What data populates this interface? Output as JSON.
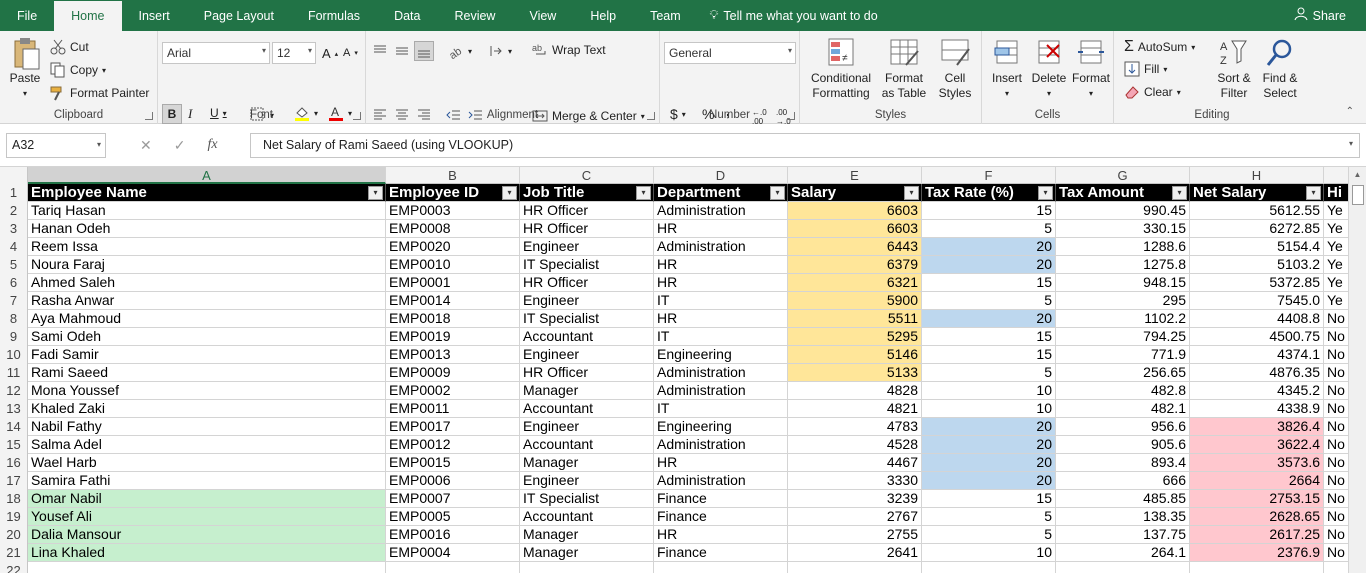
{
  "tabs": [
    "File",
    "Home",
    "Insert",
    "Page Layout",
    "Formulas",
    "Data",
    "Review",
    "View",
    "Help",
    "Team"
  ],
  "tell_me": "Tell me what you want to do",
  "share": "Share",
  "clipboard": {
    "paste": "Paste",
    "cut": "Cut",
    "copy": "Copy",
    "format_painter": "Format Painter",
    "label": "Clipboard"
  },
  "font": {
    "name": "Arial",
    "size": "12",
    "label": "Font",
    "bold": "B",
    "italic": "I",
    "underline": "U"
  },
  "alignment": {
    "wrap": "Wrap Text",
    "merge": "Merge & Center",
    "label": "Alignment"
  },
  "number": {
    "format": "General",
    "label": "Number",
    "currency": "$",
    "percent": "%",
    "comma": ","
  },
  "styles": {
    "conditional": "Conditional Formatting",
    "format_table": "Format as Table",
    "cell_styles": "Cell Styles",
    "label": "Styles"
  },
  "cells": {
    "insert": "Insert",
    "delete": "Delete",
    "format": "Format",
    "label": "Cells"
  },
  "editing": {
    "autosum": "AutoSum",
    "fill": "Fill",
    "clear": "Clear",
    "sort": "Sort & Filter",
    "find": "Find & Select",
    "label": "Editing"
  },
  "formula_bar": {
    "name_box": "A32",
    "fx": "fx",
    "content": "Net Salary of Rami Saeed (using VLOOKUP)"
  },
  "columns": [
    "A",
    "B",
    "C",
    "D",
    "E",
    "F",
    "G",
    "H"
  ],
  "headers": [
    "Employee Name",
    "Employee ID",
    "Job Title",
    "Department",
    "Salary",
    "Tax Rate (%)",
    "Tax Amount",
    "Net Salary",
    "Hi"
  ],
  "rows": [
    [
      "Tariq Hasan",
      "EMP0003",
      "HR Officer",
      "Administration",
      "6603",
      "15",
      "990.45",
      "5612.55",
      "Ye"
    ],
    [
      "Hanan Odeh",
      "EMP0008",
      "HR Officer",
      "HR",
      "6603",
      "5",
      "330.15",
      "6272.85",
      "Ye"
    ],
    [
      "Reem Issa",
      "EMP0020",
      "Engineer",
      "Administration",
      "6443",
      "20",
      "1288.6",
      "5154.4",
      "Ye"
    ],
    [
      "Noura Faraj",
      "EMP0010",
      "IT Specialist",
      "HR",
      "6379",
      "20",
      "1275.8",
      "5103.2",
      "Ye"
    ],
    [
      "Ahmed Saleh",
      "EMP0001",
      "HR Officer",
      "HR",
      "6321",
      "15",
      "948.15",
      "5372.85",
      "Ye"
    ],
    [
      "Rasha Anwar",
      "EMP0014",
      "Engineer",
      "IT",
      "5900",
      "5",
      "295",
      "7545.0",
      "Ye"
    ],
    [
      "Aya Mahmoud",
      "EMP0018",
      "IT Specialist",
      "HR",
      "5511",
      "20",
      "1102.2",
      "4408.8",
      "No"
    ],
    [
      "Sami Odeh",
      "EMP0019",
      "Accountant",
      "IT",
      "5295",
      "15",
      "794.25",
      "4500.75",
      "No"
    ],
    [
      "Fadi Samir",
      "EMP0013",
      "Engineer",
      "Engineering",
      "5146",
      "15",
      "771.9",
      "4374.1",
      "No"
    ],
    [
      "Rami Saeed",
      "EMP0009",
      "HR Officer",
      "Administration",
      "5133",
      "5",
      "256.65",
      "4876.35",
      "No"
    ],
    [
      "Mona Youssef",
      "EMP0002",
      "Manager",
      "Administration",
      "4828",
      "10",
      "482.8",
      "4345.2",
      "No"
    ],
    [
      "Khaled Zaki",
      "EMP0011",
      "Accountant",
      "IT",
      "4821",
      "10",
      "482.1",
      "4338.9",
      "No"
    ],
    [
      "Nabil Fathy",
      "EMP0017",
      "Engineer",
      "Engineering",
      "4783",
      "20",
      "956.6",
      "3826.4",
      "No"
    ],
    [
      "Salma Adel",
      "EMP0012",
      "Accountant",
      "Administration",
      "4528",
      "20",
      "905.6",
      "3622.4",
      "No"
    ],
    [
      "Wael Harb",
      "EMP0015",
      "Manager",
      "HR",
      "4467",
      "20",
      "893.4",
      "3573.6",
      "No"
    ],
    [
      "Samira Fathi",
      "EMP0006",
      "Engineer",
      "Administration",
      "3330",
      "20",
      "666",
      "2664",
      "No"
    ],
    [
      "Omar Nabil",
      "EMP0007",
      "IT Specialist",
      "Finance",
      "3239",
      "15",
      "485.85",
      "2753.15",
      "No"
    ],
    [
      "Yousef Ali",
      "EMP0005",
      "Accountant",
      "Finance",
      "2767",
      "5",
      "138.35",
      "2628.65",
      "No"
    ],
    [
      "Dalia Mansour",
      "EMP0016",
      "Manager",
      "HR",
      "2755",
      "5",
      "137.75",
      "2617.25",
      "No"
    ],
    [
      "Lina Khaled",
      "EMP0004",
      "Manager",
      "Finance",
      "2641",
      "10",
      "264.1",
      "2376.9",
      "No"
    ]
  ],
  "row_numbers": [
    "1",
    "2",
    "3",
    "4",
    "5",
    "6",
    "7",
    "8",
    "9",
    "10",
    "11",
    "12",
    "13",
    "14",
    "15",
    "16",
    "17",
    "18",
    "19",
    "20",
    "21",
    "22"
  ],
  "highlight_colors": {
    "yellow": "#ffe699",
    "blue": "#bdd7ee",
    "pink": "#ffc7ce",
    "green": "#c6efce",
    "accent": "#217346"
  }
}
